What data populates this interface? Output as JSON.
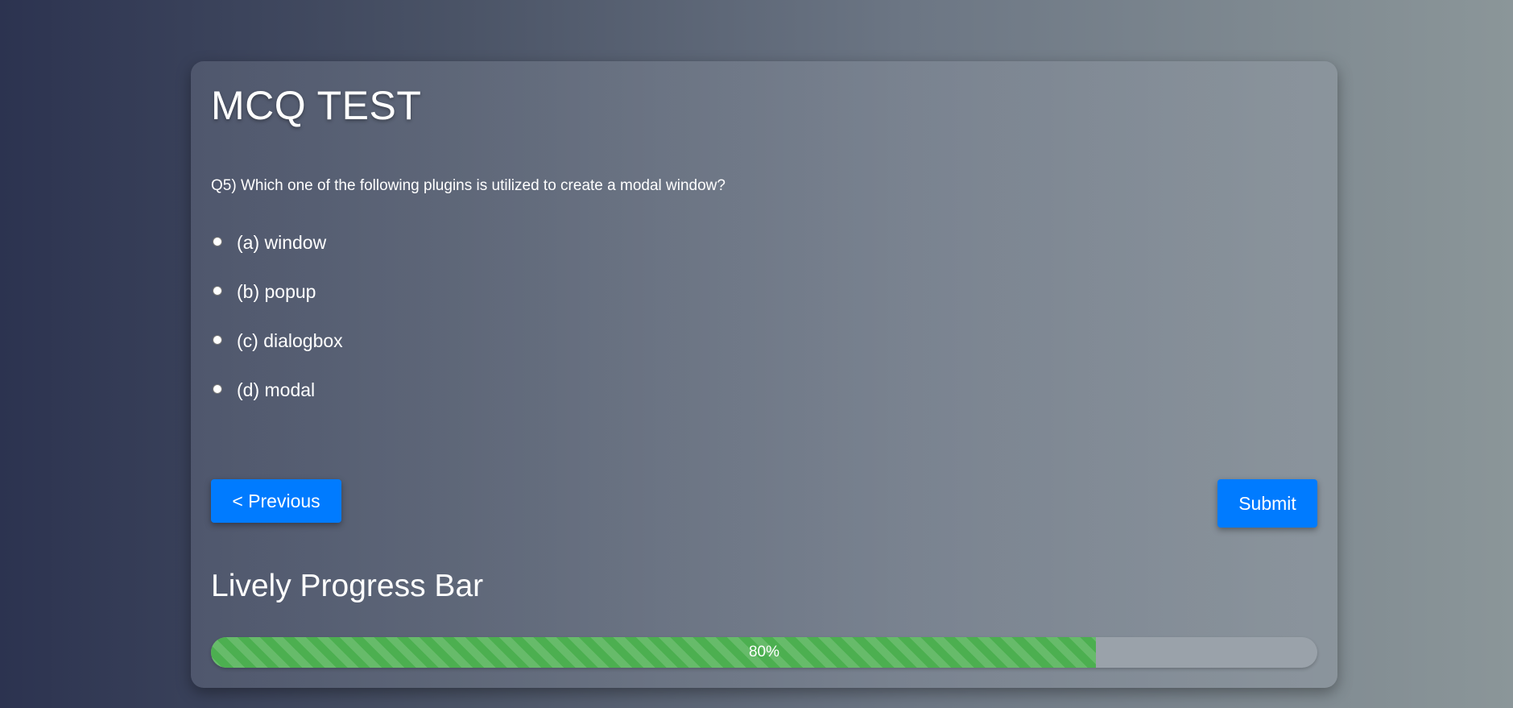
{
  "header": {
    "title": "MCQ TEST"
  },
  "question": {
    "text": "Q5) Which one of the following plugins is utilized to create a modal window?",
    "options": [
      {
        "label": "(a) window"
      },
      {
        "label": "(b) popup"
      },
      {
        "label": "(c) dialogbox"
      },
      {
        "label": "(d) modal"
      }
    ]
  },
  "nav": {
    "previous_label": "< Previous",
    "submit_label": "Submit"
  },
  "progress": {
    "title": "Lively Progress Bar",
    "value": 0.8,
    "text": "80%"
  },
  "colors": {
    "accent": "#007bff",
    "progress_fill": "#4caf50",
    "progress_track": "#9aa2aa"
  }
}
